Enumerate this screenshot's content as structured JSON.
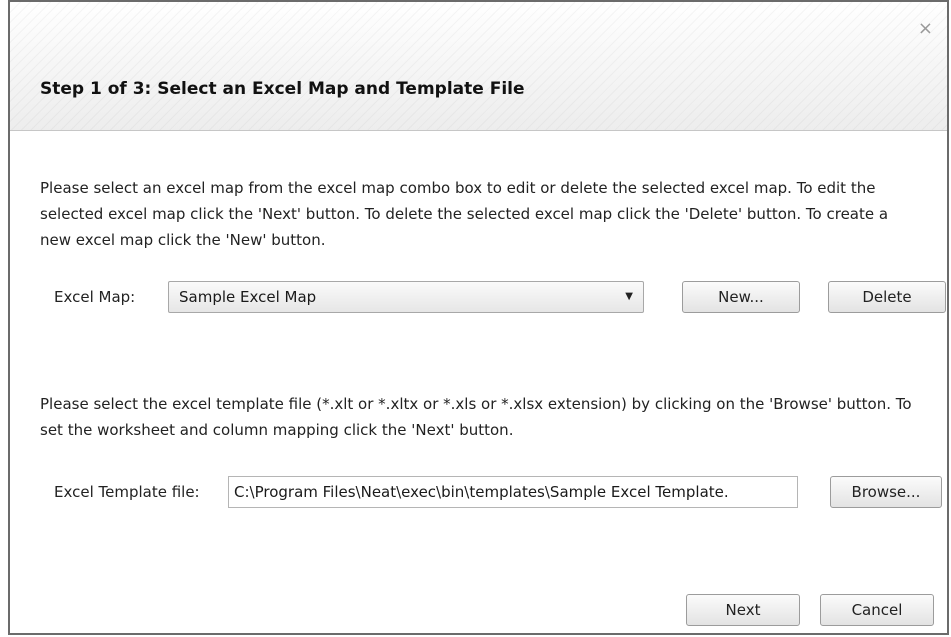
{
  "dialog": {
    "close_symbol": "×",
    "title": "Step 1 of 3: Select an Excel Map and Template File"
  },
  "map_section": {
    "description": "Please select an excel map from the excel map combo box to edit or delete the selected excel map. To edit the selected excel map click the 'Next' button. To delete the selected excel map click the 'Delete' button. To create a new excel map click the 'New' button.",
    "label": "Excel Map:",
    "selected_value": "Sample Excel Map",
    "new_label": "New...",
    "delete_label": "Delete"
  },
  "template_section": {
    "description": "Please select the excel template file (*.xlt or *.xltx or  *.xls or *.xlsx extension) by clicking on the 'Browse' button. To set the worksheet and column mapping click the 'Next' button.",
    "label": "Excel Template file:",
    "value": "C:\\Program Files\\Neat\\exec\\bin\\templates\\Sample Excel Template.",
    "browse_label": "Browse..."
  },
  "footer": {
    "next_label": "Next",
    "cancel_label": "Cancel"
  },
  "icons": {
    "close": "close-icon",
    "dropdown": "chevron-down-icon"
  }
}
